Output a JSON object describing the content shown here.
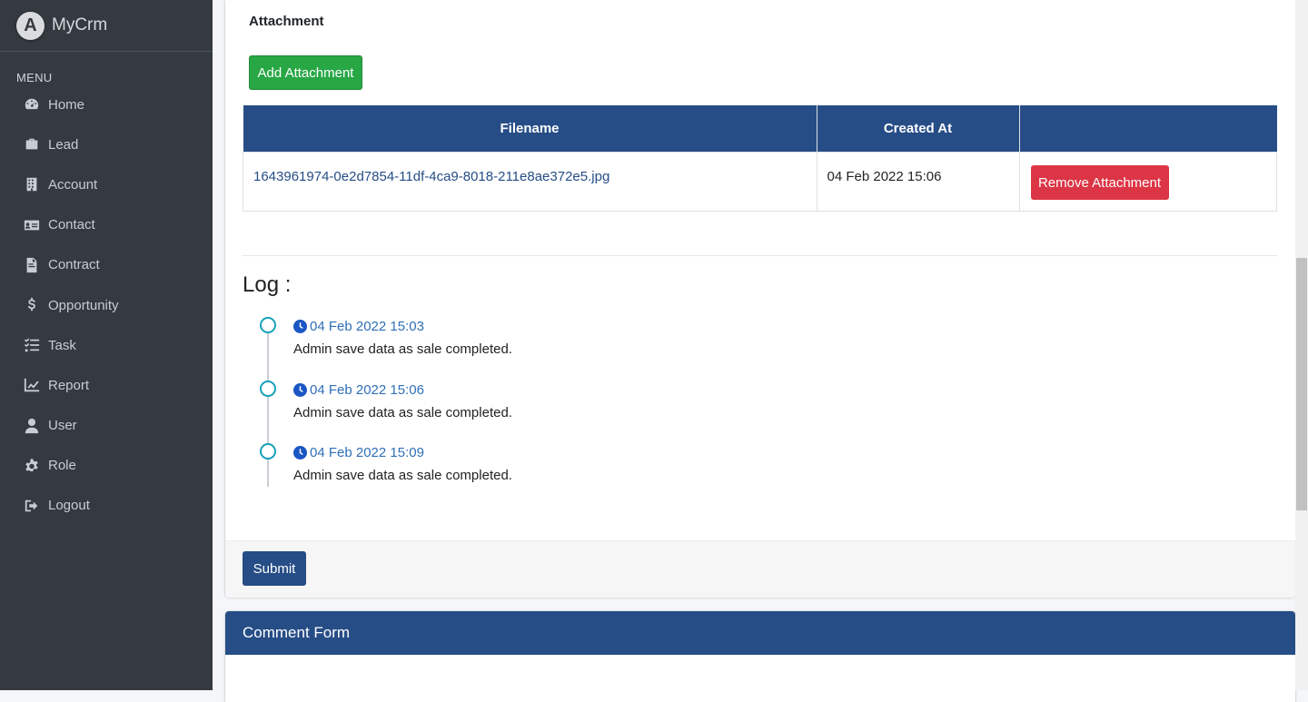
{
  "brand": {
    "name": "MyCrm",
    "logo_letter": "A"
  },
  "menu": {
    "header": "MENU",
    "items": [
      {
        "label": "Home",
        "icon": "tachometer-icon"
      },
      {
        "label": "Lead",
        "icon": "briefcase-icon"
      },
      {
        "label": "Account",
        "icon": "building-icon"
      },
      {
        "label": "Contact",
        "icon": "address-card-icon"
      },
      {
        "label": "Contract",
        "icon": "file-contract-icon"
      },
      {
        "label": "Opportunity",
        "icon": "dollar-icon"
      },
      {
        "label": "Task",
        "icon": "tasks-icon"
      },
      {
        "label": "Report",
        "icon": "chart-line-icon"
      },
      {
        "label": "User",
        "icon": "user-icon"
      },
      {
        "label": "Role",
        "icon": "gear-icon"
      },
      {
        "label": "Logout",
        "icon": "sign-out-icon"
      }
    ]
  },
  "attachment": {
    "title": "Attachment",
    "add_label": "Add Attachment",
    "columns": [
      "Filename",
      "Created At",
      ""
    ],
    "rows": [
      {
        "filename": "1643961974-0e2d7854-11df-4ca9-8018-211e8ae372e5.jpg",
        "created_at": "04 Feb 2022 15:06",
        "action_label": "Remove Attachment"
      }
    ]
  },
  "log": {
    "title": "Log :",
    "entries": [
      {
        "time": "04 Feb 2022 15:03",
        "message": "Admin save data as sale completed."
      },
      {
        "time": "04 Feb 2022 15:06",
        "message": "Admin save data as sale completed."
      },
      {
        "time": "04 Feb 2022 15:09",
        "message": "Admin save data as sale completed."
      }
    ]
  },
  "footer": {
    "submit_label": "Submit"
  },
  "comment_form": {
    "title": "Comment Form"
  },
  "colors": {
    "sidebar": "#343a40",
    "primary": "#264d86",
    "success": "#28a745",
    "danger": "#dc3545",
    "timeline_dot": "#17a2b8"
  }
}
